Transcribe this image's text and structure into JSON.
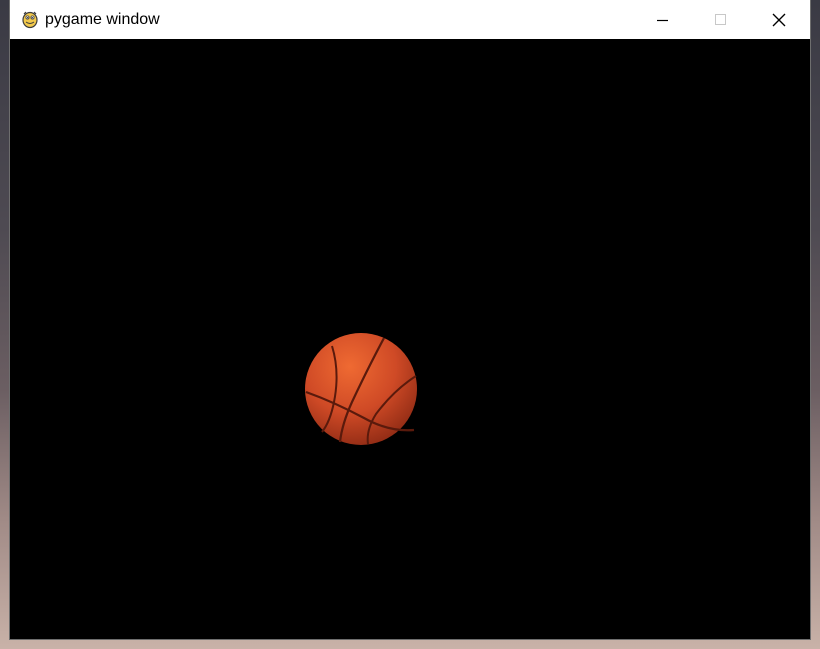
{
  "window": {
    "title": "pygame window",
    "icon": "pygame-snake-icon",
    "controls": {
      "minimize_icon": "minimize-icon",
      "maximize_icon": "maximize-icon",
      "close_icon": "close-icon"
    }
  },
  "canvas": {
    "background": "#000000",
    "sprite": "basketball-icon",
    "ball_color": "#d2502a"
  }
}
